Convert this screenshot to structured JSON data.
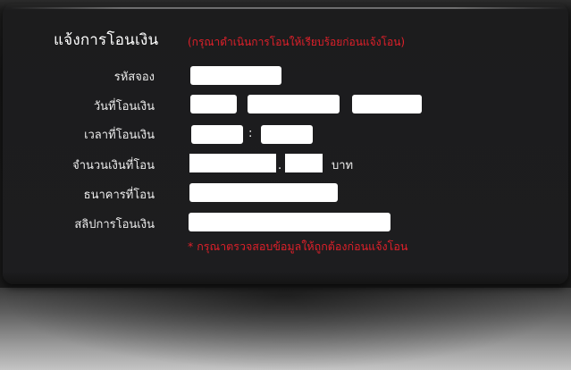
{
  "form": {
    "title": "แจ้งการโอนเงิน",
    "subtitle": "(กรุณาดำเนินการโอนให้เรียบร้อยก่อนแจ้งโอน)",
    "fields": {
      "booking_code_label": "รหัสจอง",
      "transfer_date_label": "วันที่โอนเงิน",
      "transfer_time_label": "เวลาที่โอนเงิน",
      "time_separator": ":",
      "amount_label": "จำนวนเงินที่โอน",
      "decimal_separator": ".",
      "currency_unit": "บาท",
      "bank_label": "ธนาคารที่โอน",
      "slip_label": "สลิปการโอนเงิน"
    },
    "note": "*  กรุณาตรวจสอบข้อมูลให้ถูกต้องก่อนแจ้งโอน"
  }
}
